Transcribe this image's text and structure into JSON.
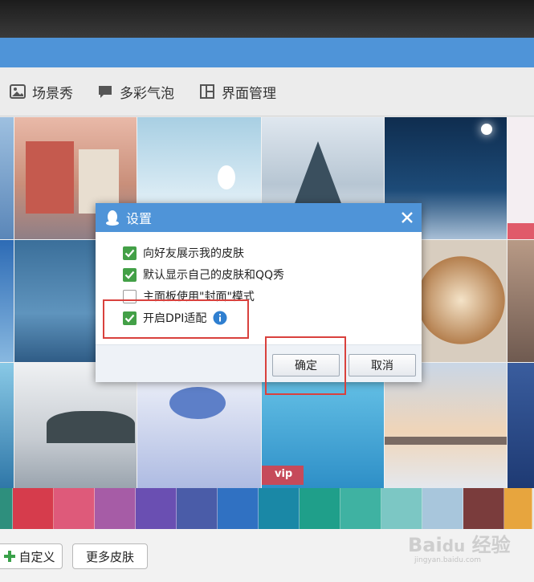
{
  "tabs": [
    {
      "label": "场景秀",
      "icon": "image-icon"
    },
    {
      "label": "多彩气泡",
      "icon": "chat-bubble-icon"
    },
    {
      "label": "界面管理",
      "icon": "layout-icon"
    }
  ],
  "grid": {
    "vip_badge": "vip"
  },
  "swatches": [
    "#2e8f7d",
    "#d63c4c",
    "#de5a7a",
    "#a65ca6",
    "#6a4fb2",
    "#4a5ca8",
    "#3071c2",
    "#1a88a6",
    "#1f9f8a",
    "#3fb2a2",
    "#7cc7c4",
    "#a8c6dc",
    "#7a3c3c",
    "#e7a53e"
  ],
  "dialog": {
    "title": "设置",
    "options": [
      {
        "label": "向好友展示我的皮肤",
        "checked": true
      },
      {
        "label": "默认显示自己的皮肤和QQ秀",
        "checked": true
      },
      {
        "label": "主面板使用\"封面\"模式",
        "checked": false
      },
      {
        "label": "开启DPI适配",
        "checked": true
      }
    ],
    "ok_label": "确定",
    "cancel_label": "取消"
  },
  "bottom": {
    "custom_label": "自定义",
    "more_label": "更多皮肤"
  },
  "colors": {
    "accent": "#4f94d8",
    "checkbox": "#43a047",
    "highlight": "#d9413d"
  }
}
